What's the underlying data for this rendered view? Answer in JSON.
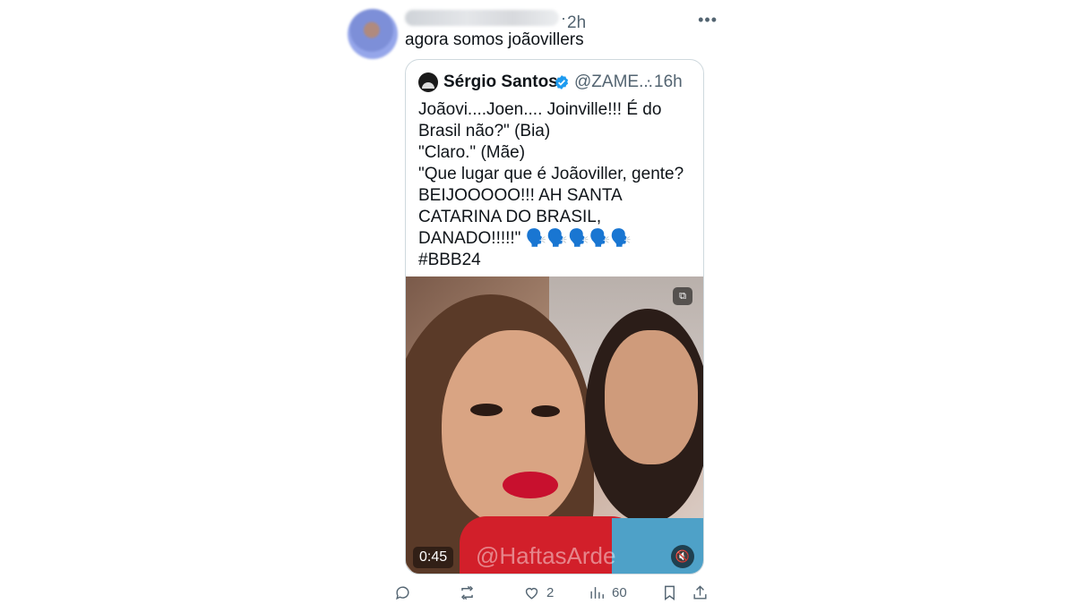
{
  "post": {
    "time": "2h",
    "text": "agora somos joãovillers",
    "more_icon": "more-icon"
  },
  "quote": {
    "author_name": "Sérgio Santos",
    "verified": true,
    "handle": "@ZAME...",
    "time": "16h",
    "text": "Joãovi....Joen.... Joinville!!! É do Brasil não?\" (Bia)\n\"Claro.\" (Mãe)\n\"Que lugar que é Joãoviller, gente? BEIJOOOOO!!! AH SANTA CATARINA DO BRASIL, DANADO!!!!!\" 🗣️🗣️🗣️🗣️🗣️\n#BBB24",
    "media": {
      "duration": "0:45",
      "watermark": "@HaftasArde",
      "badge_icon": "gif-icon",
      "mute_icon": "mute-icon"
    }
  },
  "actions": {
    "reply_count": "",
    "repost_count": "",
    "like_count": "2",
    "views_count": "60"
  },
  "colors": {
    "text": "#0f1419",
    "secondary": "#536471",
    "border": "#cfd9de",
    "verified": "#1d9bf0"
  }
}
